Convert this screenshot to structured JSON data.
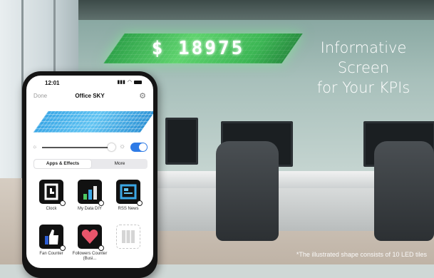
{
  "banner": {
    "led_value": "$ 18975",
    "headline_lines": [
      "Informative",
      "Screen",
      "for Your KPIs"
    ],
    "footnote": "*The illustrated shape consists of 10 LED tiles",
    "led_color": "#4cc862",
    "preview_color": "#3aa7e6"
  },
  "phone": {
    "status": {
      "time": "12:01",
      "icons": [
        "signal-icon",
        "wifi-icon",
        "battery-icon"
      ]
    },
    "nav": {
      "done_label": "Done",
      "title": "Office SKY",
      "settings_icon": "gear-icon"
    },
    "brightness": {
      "level": 0.9,
      "toggle_on": true,
      "accent": "#2e7be6"
    },
    "tabs": [
      {
        "label": "Apps & Effects",
        "active": true
      },
      {
        "label": "More",
        "active": false
      }
    ],
    "apps": [
      {
        "label": "Clock",
        "icon": "clock-icon"
      },
      {
        "label": "My Data DIY",
        "icon": "data-diy-icon"
      },
      {
        "label": "RSS News",
        "icon": "rss-news-icon"
      },
      {
        "label": "Fan Counter",
        "icon": "thumbs-up-icon"
      },
      {
        "label": "Followers Counter (Busi...",
        "icon": "heart-icon"
      },
      {
        "label": "",
        "icon": "add-grid-icon"
      }
    ]
  }
}
